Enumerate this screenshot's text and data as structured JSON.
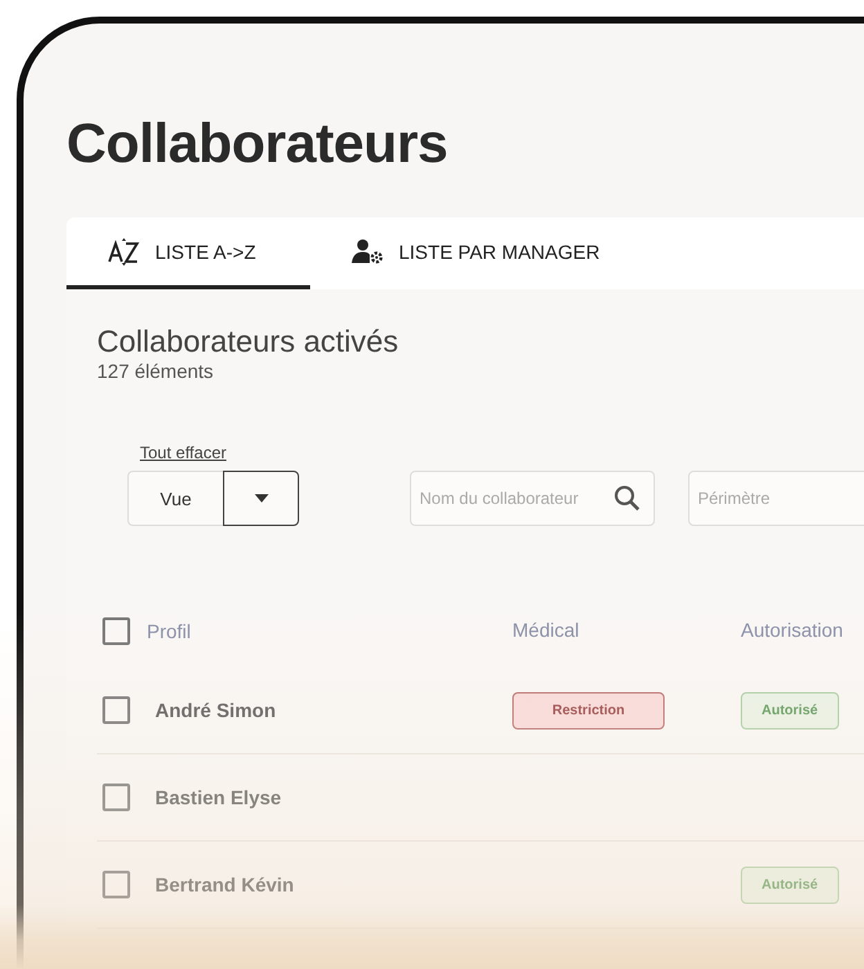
{
  "page_title": "Collaborateurs",
  "tabs": [
    {
      "label": "LISTE A->Z",
      "selected": true
    },
    {
      "label": "LISTE PAR MANAGER",
      "selected": false
    }
  ],
  "list": {
    "title": "Collaborateurs activés",
    "count": "127 éléments"
  },
  "filters": {
    "clear_link": "Tout effacer",
    "view_button": "Vue",
    "search": {
      "placeholder": "Nom du collaborateur"
    },
    "scope": {
      "placeholder": "Périmètre"
    }
  },
  "table": {
    "columns": [
      "Profil",
      "Médical",
      "Autorisation"
    ],
    "header_checked": false,
    "rows": [
      {
        "name": "André Simon",
        "checked": false,
        "medical": {
          "label": "Restriction",
          "kind": "restriction"
        },
        "authorization": {
          "label": "Autorisé",
          "kind": "authorized"
        }
      },
      {
        "name": "Bastien Elyse",
        "checked": false
      },
      {
        "name": "Bertrand Kévin",
        "checked": false,
        "authorization": {
          "label": "Autorisé",
          "kind": "authorized"
        }
      }
    ]
  }
}
